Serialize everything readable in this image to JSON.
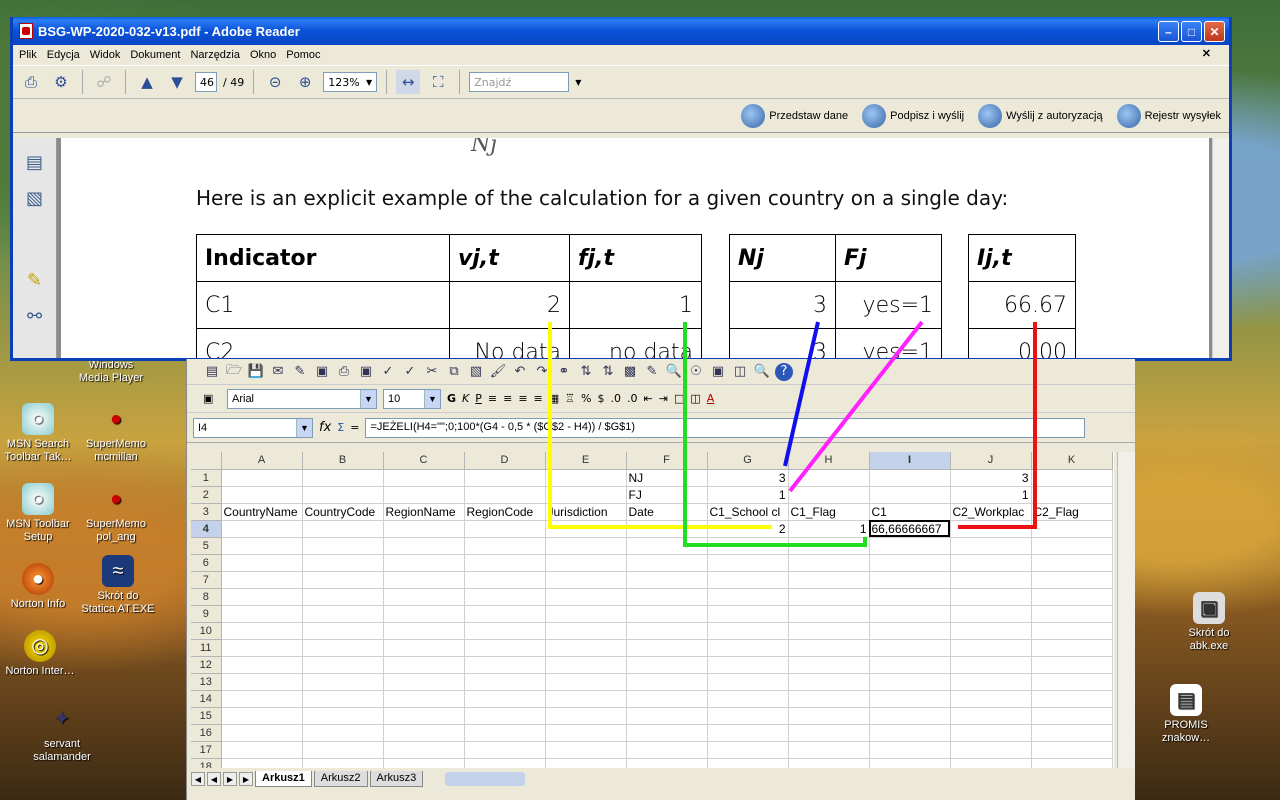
{
  "desktop": {
    "icons": [
      {
        "label": "MSN Search Toolbar Tak…"
      },
      {
        "label": "SuperMemo mcmillan"
      },
      {
        "label": "MSN Toolbar Setup"
      },
      {
        "label": "SuperMemo pol_ang"
      },
      {
        "label": "Norton Info"
      },
      {
        "label": "Skrót do Statica AT.EXE"
      },
      {
        "label": "Norton Inter…"
      },
      {
        "label": "servant salamander"
      },
      {
        "label": "Skrót do abk.exe"
      },
      {
        "label": "PROMIS znakow…"
      },
      {
        "label": "Windows Media Player"
      }
    ]
  },
  "reader": {
    "title": "BSG-WP-2020-032-v13.pdf - Adobe Reader",
    "menu": [
      "Plik",
      "Edycja",
      "Widok",
      "Dokument",
      "Narzędzia",
      "Okno",
      "Pomoc"
    ],
    "page_current": "46",
    "page_total": "/ 49",
    "zoom": "123%",
    "find_placeholder": "Znajdź",
    "actions": [
      "Przedstaw dane",
      "Podpisz i wyślij",
      "Wyślij z autoryzacją",
      "Rejestr wysyłek"
    ],
    "content": {
      "symbol": "Nj",
      "sentence": "Here is an explicit example of the calculation for a given country on a single day:",
      "table1": {
        "headers": [
          "Indicator",
          "vj,t",
          "fj,t"
        ],
        "rows": [
          [
            "C1",
            "2",
            "1"
          ],
          [
            "C2",
            "No data",
            "no data"
          ]
        ]
      },
      "table2": {
        "headers": [
          "Nj",
          "Fj"
        ],
        "rows": [
          [
            "3",
            "yes=1"
          ],
          [
            "3",
            "yes=1"
          ]
        ]
      },
      "table3": {
        "headers": [
          "Ij,t"
        ],
        "rows": [
          [
            "66.67"
          ],
          [
            "0.00"
          ]
        ]
      }
    }
  },
  "calc": {
    "font_name": "Arial",
    "font_size": "10",
    "cell_ref": "I4",
    "formula": "=JEŻELI(H4=\"\";0;100*(G4 - 0,5 * ($G$2 - H4)) / $G$1)",
    "columns": [
      "A",
      "B",
      "C",
      "D",
      "E",
      "F",
      "G",
      "H",
      "I",
      "J",
      "K"
    ],
    "rows": [
      [
        "",
        "",
        "",
        "",
        "",
        "NJ",
        "3",
        "",
        "",
        "3",
        ""
      ],
      [
        "",
        "",
        "",
        "",
        "",
        "FJ",
        "1",
        "",
        "",
        "1",
        ""
      ],
      [
        "CountryName",
        "CountryCode",
        "RegionName",
        "RegionCode",
        "Jurisdiction",
        "Date",
        "C1_School cl",
        "C1_Flag",
        "C1",
        "C2_Workplac",
        "C2_Flag"
      ],
      [
        "",
        "",
        "",
        "",
        "",
        "",
        "2",
        "1",
        "66,66666667",
        "",
        ""
      ],
      [
        "",
        "",
        "",
        "",
        "",
        "",
        "",
        "",
        "",
        "",
        ""
      ],
      [
        "",
        "",
        "",
        "",
        "",
        "",
        "",
        "",
        "",
        "",
        ""
      ],
      [
        "",
        "",
        "",
        "",
        "",
        "",
        "",
        "",
        "",
        "",
        ""
      ],
      [
        "",
        "",
        "",
        "",
        "",
        "",
        "",
        "",
        "",
        "",
        ""
      ],
      [
        "",
        "",
        "",
        "",
        "",
        "",
        "",
        "",
        "",
        "",
        ""
      ],
      [
        "",
        "",
        "",
        "",
        "",
        "",
        "",
        "",
        "",
        "",
        ""
      ],
      [
        "",
        "",
        "",
        "",
        "",
        "",
        "",
        "",
        "",
        "",
        ""
      ],
      [
        "",
        "",
        "",
        "",
        "",
        "",
        "",
        "",
        "",
        "",
        ""
      ],
      [
        "",
        "",
        "",
        "",
        "",
        "",
        "",
        "",
        "",
        "",
        ""
      ],
      [
        "",
        "",
        "",
        "",
        "",
        "",
        "",
        "",
        "",
        "",
        ""
      ],
      [
        "",
        "",
        "",
        "",
        "",
        "",
        "",
        "",
        "",
        "",
        ""
      ],
      [
        "",
        "",
        "",
        "",
        "",
        "",
        "",
        "",
        "",
        "",
        ""
      ],
      [
        "",
        "",
        "",
        "",
        "",
        "",
        "",
        "",
        "",
        "",
        ""
      ],
      [
        "",
        "",
        "",
        "",
        "",
        "",
        "",
        "",
        "",
        "",
        ""
      ]
    ],
    "sheets": [
      "Arkusz1",
      "Arkusz2",
      "Arkusz3"
    ]
  },
  "annotation_colors": {
    "yellow": "#ffff00",
    "green": "#22dd22",
    "blue": "#1010ee",
    "magenta": "#ff22ff",
    "red": "#ee1111"
  }
}
